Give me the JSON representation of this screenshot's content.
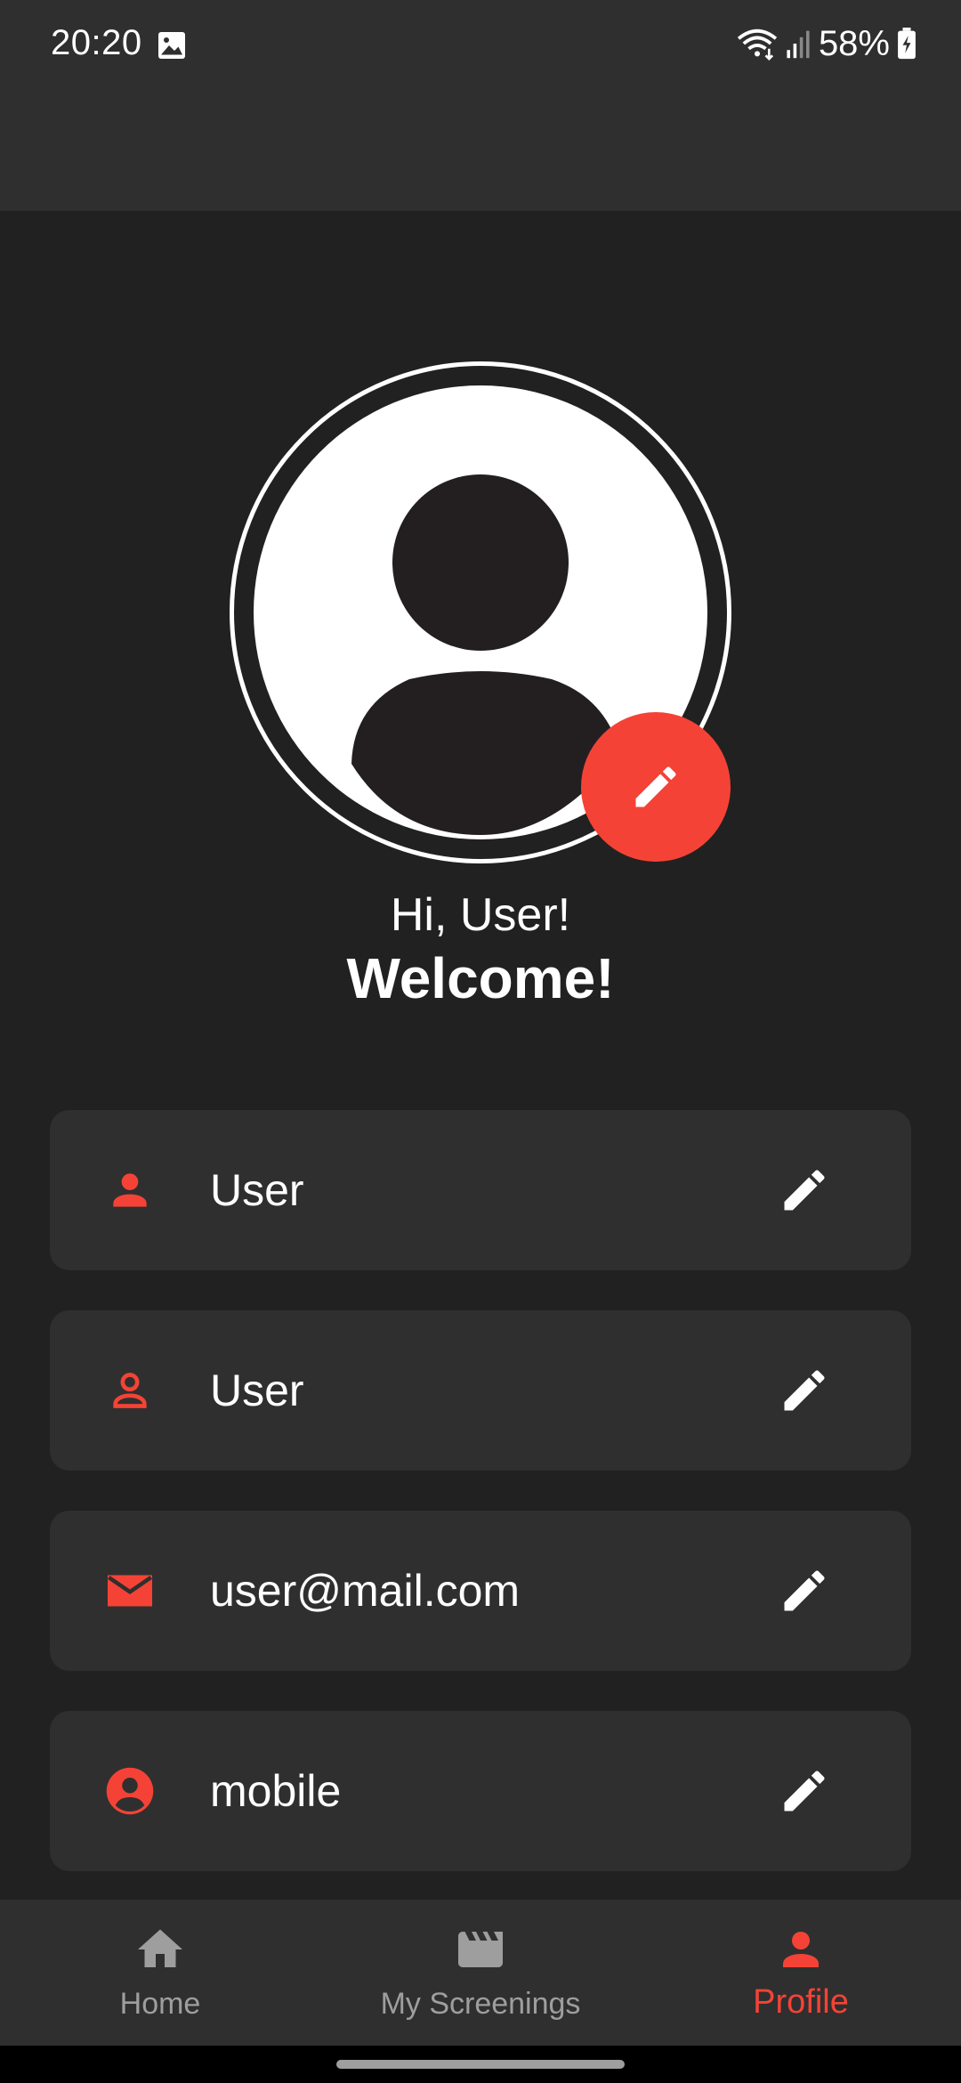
{
  "status_bar": {
    "time": "20:20",
    "battery_percent": "58%",
    "icons": [
      "gallery-icon",
      "wifi-icon",
      "signal-icon",
      "battery-charging-icon"
    ]
  },
  "profile": {
    "greeting": "Hi, User!",
    "welcome": "Welcome!",
    "avatar_icon": "account-circle-icon",
    "avatar_edit_icon": "pencil-icon"
  },
  "fields": [
    {
      "icon": "person-icon",
      "value": "User",
      "edit_icon": "pencil-icon"
    },
    {
      "icon": "person-outline-icon",
      "value": "User",
      "edit_icon": "pencil-icon"
    },
    {
      "icon": "mail-icon",
      "value": "user@mail.com",
      "edit_icon": "pencil-icon"
    },
    {
      "icon": "account-circle-icon",
      "value": "mobile",
      "edit_icon": "pencil-icon"
    }
  ],
  "bottom_nav": {
    "items": [
      {
        "label": "Home",
        "icon": "home-icon",
        "active": false
      },
      {
        "label": "My Screenings",
        "icon": "movie-clapper-icon",
        "active": false
      },
      {
        "label": "Profile",
        "icon": "person-icon",
        "active": true
      }
    ]
  },
  "colors": {
    "accent": "#f44336",
    "background": "#212121",
    "surface": "#2f2f2f",
    "inactive": "#9e9e9e",
    "text": "#ffffff"
  }
}
